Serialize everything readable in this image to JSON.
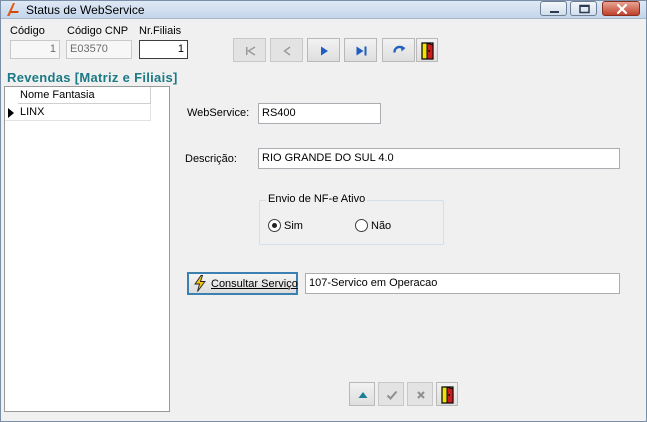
{
  "window": {
    "title": "Status de WebService"
  },
  "header_fields": {
    "codigo_label": "Código",
    "codigo_value": "1",
    "codigo_cnp_label": "Código CNP",
    "codigo_cnp_value": "E03570",
    "nr_filiais_label": "Nr.Filiais",
    "nr_filiais_value": "1"
  },
  "navigator": {
    "buttons": [
      "first-record",
      "prior-record",
      "next-record",
      "last-record",
      "refresh",
      "exit"
    ]
  },
  "revendas": {
    "title": "Revendas [Matriz e Filiais]",
    "column_header": "Nome Fantasia",
    "rows": [
      "LINX"
    ]
  },
  "form": {
    "webservice_label": "WebService:",
    "webservice_value": "RS400",
    "descricao_label": "Descrição:",
    "descricao_value": "RIO GRANDE DO SUL 4.0",
    "envio_group_label": "Envio de NF-e Ativo",
    "option_sim": "Sim",
    "option_nao": "Não",
    "selected_option": "Sim",
    "consult_button_label": "Consultar Serviço",
    "consult_result": "107-Servico em Operacao"
  },
  "bottom_toolbar": {
    "buttons": [
      "post-up",
      "confirm",
      "cancel",
      "exit"
    ]
  },
  "colors": {
    "section_title": "#1b7a85",
    "nav_arrow": "#1f5fbf",
    "exit_icon": "#f2e300"
  }
}
